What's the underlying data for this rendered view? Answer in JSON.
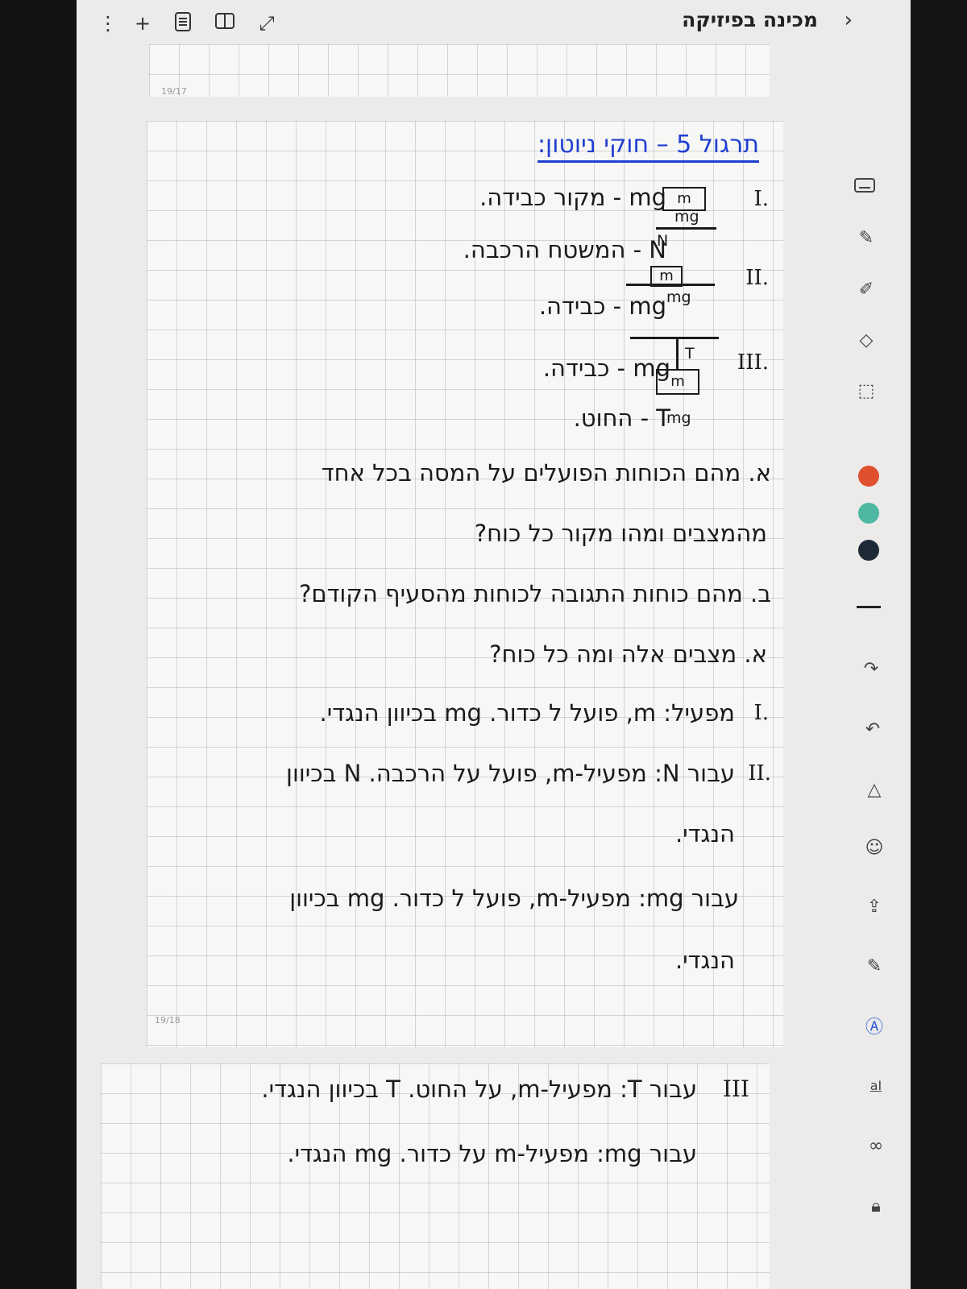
{
  "app": {
    "notebook_title": "מכינה בפיזיקה",
    "top_icons": [
      "more-vertical-icon",
      "plus-icon",
      "document-icon",
      "book-icon",
      "expand-icon"
    ]
  },
  "pages": {
    "page1_number": "19/17",
    "page2_number": "19/18"
  },
  "note": {
    "heading": "תרגול 5 – חוקי ניוטון:",
    "diagrams": {
      "d1_roman": "I.",
      "d1_mass": "m",
      "d1_force": "mg",
      "d2_roman": "II.",
      "d2_mass": "m",
      "d2_up": "N",
      "d2_down": "mg",
      "d3_roman": "III.",
      "d3_mass": "m",
      "d3_up": "T",
      "d3_down": "mg"
    },
    "force_labels": [
      "mg - מקור כבידה.",
      "N - המשטח הרכבה.",
      "mg - כבידה.",
      "mg - כבידה.",
      "T - החוט."
    ],
    "question_lines": [
      "א. מהם הכוחות הפועלים על המסה בכל אחד",
      "מהמצבים ומהו מקור כל כוח?",
      "ב. מהם כוחות התגובה לכוחות מהסעיף הקודם?",
      "א. מצבים אלה ומה כל כוח?"
    ],
    "answers": {
      "a1_roman": "I.",
      "a1": "מפעיל: m, פועל ל כדור. mg בכיוון הנגדי.",
      "a2_roman": "II.",
      "a2_line1": "עבור N: מפעיל-m, פועל על הרכבה. N בכיוון",
      "a2_line2": "הנגדי.",
      "a3_line1": "עבור mg: מפעיל-m, פועל ל כדור. mg בכיוון",
      "a3_line2": "הנגדי.",
      "a4_roman": "III",
      "a4": "עבור T: מפעיל-m, על החוט. T בכיוון הנגדי.",
      "a5": "עבור mg: מפעיל-m על כדור. mg הנגדי."
    }
  },
  "toolbar": {
    "tools": [
      "keyboard-icon",
      "pen-icon",
      "highlighter-icon",
      "eraser-icon",
      "lasso-icon"
    ],
    "colors": [
      "#e0502e",
      "#4fb8a3",
      "#1e2a36"
    ],
    "tools2": [
      "redo-icon",
      "undo-icon",
      "shape-icon",
      "sticker-icon",
      "insert-icon",
      "marker-icon",
      "text-icon",
      "convert-text-icon",
      "link-icon",
      "lock-icon"
    ],
    "convert_label": "aI"
  }
}
